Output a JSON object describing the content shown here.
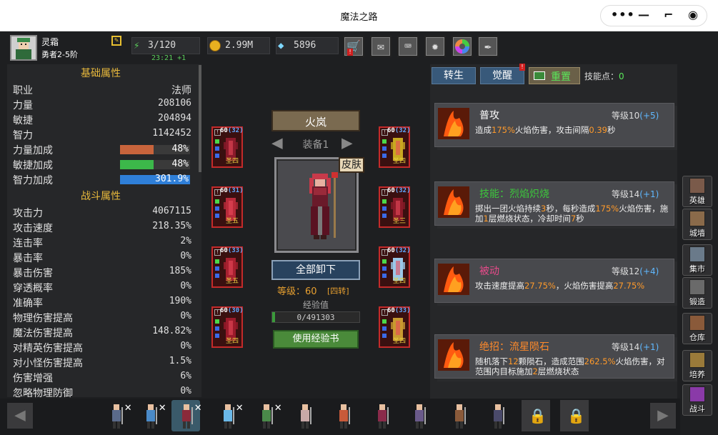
{
  "window": {
    "title": "魔法之路"
  },
  "capsule": {
    "more_icon": "more-dots",
    "minimize_icon": "minus",
    "restore_icon": "restore",
    "record_icon": "target"
  },
  "player": {
    "name": "灵霜",
    "rank": "勇者2-5阶",
    "edit_icon": "pencil"
  },
  "resources": {
    "stamina": "3/120",
    "stamina_timer": "23:21 +1",
    "gold": "2.99M",
    "diamonds": "5896"
  },
  "toolbar": [
    "shop-cart",
    "mail",
    "gamepad",
    "settings-gear",
    "color-wheel",
    "feather"
  ],
  "basic_section": {
    "title": "基础属性"
  },
  "basic_stats": [
    {
      "label": "职业",
      "value": "法师"
    },
    {
      "label": "力量",
      "value": "208106"
    },
    {
      "label": "敏捷",
      "value": "204894"
    },
    {
      "label": "智力",
      "value": "1142452"
    }
  ],
  "bonus_stats": [
    {
      "label": "力量加成",
      "value": "48%",
      "color": "#c8643c",
      "fill": 0.48
    },
    {
      "label": "敏捷加成",
      "value": "48%",
      "color": "#3cb84a",
      "fill": 0.48
    },
    {
      "label": "智力加成",
      "value": "301.9%",
      "color": "#2f7fd8",
      "fill": 1.0
    }
  ],
  "battle_section": {
    "title": "战斗属性"
  },
  "battle_stats": [
    {
      "label": "攻击力",
      "value": "4067115"
    },
    {
      "label": "攻击速度",
      "value": "218.35%"
    },
    {
      "label": "连击率",
      "value": "2%"
    },
    {
      "label": "暴击率",
      "value": "0%"
    },
    {
      "label": "暴击伤害",
      "value": "185%"
    },
    {
      "label": "穿透概率",
      "value": "0%"
    },
    {
      "label": "准确率",
      "value": "190%"
    },
    {
      "label": "物理伤害提高",
      "value": "0%"
    },
    {
      "label": "魔法伤害提高",
      "value": "148.82%"
    },
    {
      "label": "对精英伤害提高",
      "value": "0%"
    },
    {
      "label": "对小怪伤害提高",
      "value": "1.5%"
    },
    {
      "label": "伤害增强",
      "value": "6%"
    },
    {
      "label": "忽略物理防御",
      "value": "0%"
    }
  ],
  "character": {
    "name": "火岚",
    "equip_set": "装备1",
    "skin_label": "皮肤",
    "unequip_all": "全部卸下",
    "level_text": "等级：60",
    "rebirth": "[四转]",
    "exp_label": "经验值",
    "exp_value": "0/491303",
    "exp_fill": 0.0,
    "use_exp_book": "使用经验书"
  },
  "equipment_left": [
    {
      "level": "60",
      "plus": "(32)",
      "tag": "圣四",
      "item": "hood"
    },
    {
      "level": "60",
      "plus": "(31)",
      "tag": "圣五",
      "item": "armor"
    },
    {
      "level": "60",
      "plus": "(33)",
      "tag": "圣五",
      "item": "pants"
    },
    {
      "level": "60",
      "plus": "(30)",
      "tag": "圣四",
      "item": "boots"
    }
  ],
  "equipment_right": [
    {
      "level": "60",
      "plus": "(32)",
      "tag": "圣四",
      "item": "amulet"
    },
    {
      "level": "60",
      "plus": "(32)",
      "tag": "圣三",
      "item": "gloves"
    },
    {
      "level": "60",
      "plus": "(32)",
      "tag": "圣四",
      "item": "blade"
    },
    {
      "level": "60",
      "plus": "(33)",
      "tag": "圣四",
      "item": "staff"
    }
  ],
  "skill_tabs": {
    "rebirth": "转生",
    "awaken": "觉醒",
    "reset": "重置",
    "points_label": "技能点：",
    "points": "0"
  },
  "skills": [
    {
      "name": "普攻",
      "name_color": "#ffffff",
      "level": "等级10",
      "plus": "(+5)",
      "desc": [
        [
          "造成",
          ""
        ],
        [
          "175%",
          "hl"
        ],
        [
          "火焰伤害，攻击间隔",
          ""
        ],
        [
          "0.39",
          "hl"
        ],
        [
          "秒",
          ""
        ]
      ]
    },
    {
      "name": "技能：烈焰炽烧",
      "name_color": "#3cc83c",
      "level": "等级14",
      "plus": "(+1)",
      "desc": [
        [
          "掷出一团火焰持续",
          ""
        ],
        [
          "3",
          "hl"
        ],
        [
          "秒，每秒造成",
          ""
        ],
        [
          "175%",
          "hl"
        ],
        [
          "火焰伤害，施加",
          ""
        ],
        [
          "1",
          "hl"
        ],
        [
          "层燃烧状态，冷却时间",
          ""
        ],
        [
          "7",
          "hl"
        ],
        [
          "秒",
          ""
        ]
      ]
    },
    {
      "name": "被动",
      "name_color": "#e84a8a",
      "level": "等级12",
      "plus": "(+4)",
      "desc": [
        [
          "攻击速度提高",
          ""
        ],
        [
          "27.75%",
          "hl"
        ],
        [
          "，火焰伤害提高",
          ""
        ],
        [
          "27.75%",
          "hl"
        ]
      ]
    },
    {
      "name": "绝招：流星陨石",
      "name_color": "#ff8a2a",
      "level": "等级14",
      "plus": "(+1)",
      "desc": [
        [
          "随机落下",
          ""
        ],
        [
          "12",
          "hl"
        ],
        [
          "颗陨石，造成范围",
          ""
        ],
        [
          "262.5%",
          "hl"
        ],
        [
          "火焰伤害，对范围内目标施加",
          ""
        ],
        [
          "2",
          "hl"
        ],
        [
          "层燃烧状态",
          ""
        ]
      ]
    }
  ],
  "side_menu": [
    {
      "label": "英雄",
      "icon": "hero-icon"
    },
    {
      "label": "城墙",
      "icon": "wall-icon"
    },
    {
      "label": "集市",
      "icon": "market-icon"
    },
    {
      "label": "锻造",
      "icon": "anvil-icon"
    },
    {
      "label": "仓库",
      "icon": "warehouse-icon"
    },
    {
      "label": "培养",
      "icon": "trophy-icon"
    },
    {
      "label": "战斗",
      "icon": "battle-icon"
    }
  ],
  "heroes": [
    {
      "id": "h1",
      "in_team": true
    },
    {
      "id": "h2",
      "in_team": true
    },
    {
      "id": "h3",
      "in_team": true,
      "selected": true
    },
    {
      "id": "h4",
      "in_team": true
    },
    {
      "id": "h5",
      "in_team": true
    },
    {
      "id": "h6",
      "in_team": false
    },
    {
      "id": "h7",
      "in_team": false
    },
    {
      "id": "h8",
      "in_team": false
    },
    {
      "id": "h9",
      "in_team": false
    },
    {
      "id": "h10",
      "in_team": false
    },
    {
      "id": "h11",
      "in_team": false
    },
    {
      "id": "h12",
      "locked": true
    },
    {
      "id": "h13",
      "locked": true
    }
  ]
}
